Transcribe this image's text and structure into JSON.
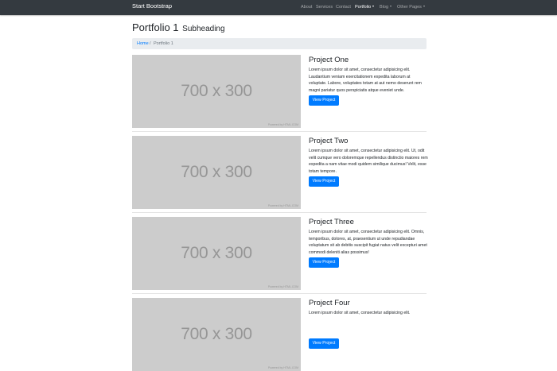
{
  "navbar": {
    "brand": "Start Bootstrap",
    "items": [
      {
        "label": "About",
        "dropdown": false,
        "active": false
      },
      {
        "label": "Services",
        "dropdown": false,
        "active": false
      },
      {
        "label": "Contact",
        "dropdown": false,
        "active": false
      },
      {
        "label": "Portfolio",
        "dropdown": true,
        "active": true
      },
      {
        "label": "Blog",
        "dropdown": true,
        "active": false
      },
      {
        "label": "Other Pages",
        "dropdown": true,
        "active": false
      }
    ]
  },
  "page": {
    "title": "Portfolio 1",
    "subtitle": "Subheading"
  },
  "breadcrumb": {
    "home": "Home",
    "separator": "/",
    "current": "Portfolio 1"
  },
  "projects": [
    {
      "image_text": "700 x 300",
      "image_credit": "Powered by HTML.COM",
      "title": "Project One",
      "description": "Lorem ipsum dolor sit amet, consectetur adipisicing elit. Laudantium veniam exercitationem expedita laborum at voluptate. Labore, voluptates totam at aut nemo deserunt rem magni pariatur quos perspiciatis atque eveniet unde.",
      "button": "View Project"
    },
    {
      "image_text": "700 x 300",
      "image_credit": "Powered by HTML.COM",
      "title": "Project Two",
      "description": "Lorem ipsum dolor sit amet, consectetur adipisicing elit. Ut, odit velit cumque vero doloremque repellendus distinctio maiores rem expedita a nam vitae modi quidem similique ducimus! Velit, esse totam tempore.",
      "button": "View Project"
    },
    {
      "image_text": "700 x 300",
      "image_credit": "Powered by HTML.COM",
      "title": "Project Three",
      "description": "Lorem ipsum dolor sit amet, consectetur adipisicing elit. Omnis, temporibus, dolores, at, praesentium ut unde repudiandae voluptatum sit ab debitis suscipit fugiat natus velit excepturi amet commodi deleniti alias possimus!",
      "button": "View Project"
    },
    {
      "image_text": "700 x 300",
      "image_credit": "Powered by HTML.COM",
      "title": "Project Four",
      "description": "Lorem ipsum dolor sit amet, consectetur adipisicing elit.",
      "button": "View Project"
    }
  ],
  "colors": {
    "navbar_bg": "#343a40",
    "primary": "#007bff",
    "breadcrumb_bg": "#e9ecef",
    "placeholder_bg": "#cccccc",
    "placeholder_text": "#969696"
  }
}
